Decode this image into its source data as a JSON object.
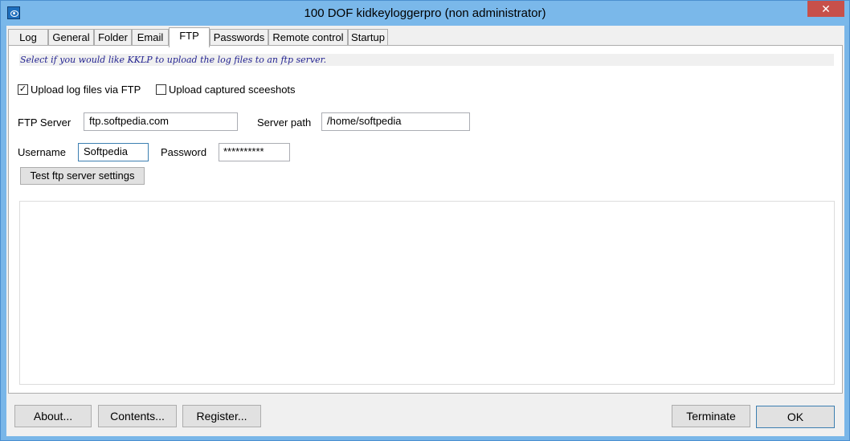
{
  "window": {
    "title": "100 DOF kidkeyloggerpro (non administrator)",
    "icon": "eye-app-icon",
    "close_label": "✕"
  },
  "tabs": [
    {
      "label": "Log"
    },
    {
      "label": "General"
    },
    {
      "label": "Folder"
    },
    {
      "label": "Email"
    },
    {
      "label": "FTP",
      "active": true
    },
    {
      "label": "Passwords"
    },
    {
      "label": "Remote control"
    },
    {
      "label": "Startup"
    }
  ],
  "ftp": {
    "info": "Select if you would like KKLP to upload the log files to an ftp server.",
    "upload_logs": {
      "label": "Upload log files via FTP",
      "checked": true,
      "mark": "✓"
    },
    "upload_screenshots": {
      "label": "Upload captured sceeshots",
      "checked": false
    },
    "ftp_server": {
      "label": "FTP Server",
      "value": "ftp.softpedia.com"
    },
    "server_path": {
      "label": "Server path",
      "value": "/home/softpedia"
    },
    "username": {
      "label": "Username",
      "value": "Softpedia"
    },
    "password": {
      "label": "Password",
      "value": "**********"
    },
    "test_button": "Test ftp server settings",
    "log_output": ""
  },
  "footer": {
    "about": "About...",
    "contents": "Contents...",
    "register": "Register...",
    "terminate": "Terminate",
    "ok": "OK"
  },
  "colors": {
    "titlebar": "#7ab8ea",
    "close_button": "#c7504a",
    "info_text": "#1f1f8f"
  }
}
